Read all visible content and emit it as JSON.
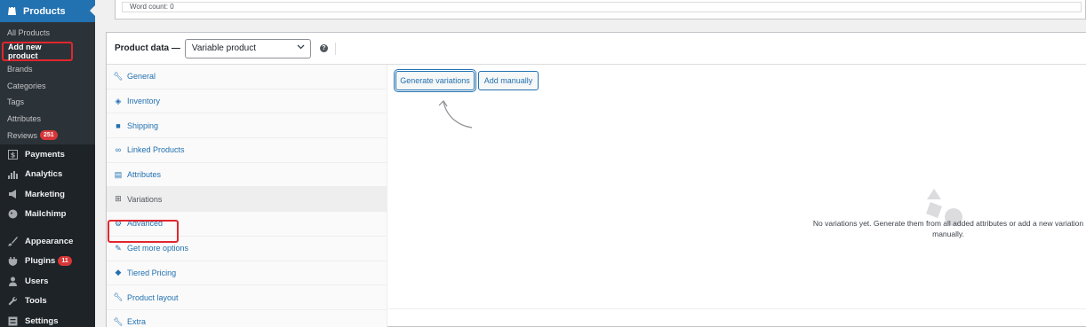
{
  "sidebar": {
    "current_menu": {
      "label": "Products",
      "icon": "products-bag-icon"
    },
    "submenu": [
      {
        "label": "All Products"
      },
      {
        "label": "Add new product",
        "active": true
      },
      {
        "label": "Brands"
      },
      {
        "label": "Categories"
      },
      {
        "label": "Tags"
      },
      {
        "label": "Attributes"
      },
      {
        "label": "Reviews",
        "badge": "251"
      }
    ],
    "menu": [
      {
        "label": "Payments",
        "icon": "payments-dollar-icon"
      },
      {
        "label": "Analytics",
        "icon": "analytics-bar-icon"
      },
      {
        "label": "Marketing",
        "icon": "marketing-megaphone-icon"
      },
      {
        "label": "Mailchimp",
        "icon": "mailchimp-icon"
      },
      {
        "label": "Appearance",
        "icon": "appearance-brush-icon"
      },
      {
        "label": "Plugins",
        "icon": "plugins-plug-icon",
        "badge": "11"
      },
      {
        "label": "Users",
        "icon": "users-icon"
      },
      {
        "label": "Tools",
        "icon": "tools-wrench-icon"
      },
      {
        "label": "Settings",
        "icon": "settings-icon"
      }
    ]
  },
  "editor": {
    "word_count": "Word count: 0"
  },
  "product_data": {
    "title": "Product data —",
    "type_select": {
      "value": "Variable product"
    },
    "help_icon": "help-icon",
    "tabs": [
      {
        "label": "General",
        "icon": "wrench-icon"
      },
      {
        "label": "Inventory",
        "icon": "tag-icon"
      },
      {
        "label": "Shipping",
        "icon": "truck-icon"
      },
      {
        "label": "Linked Products",
        "icon": "link-icon"
      },
      {
        "label": "Attributes",
        "icon": "list-card-icon"
      },
      {
        "label": "Variations",
        "icon": "grid-icon",
        "active": true
      },
      {
        "label": "Advanced",
        "icon": "gear-icon"
      },
      {
        "label": "Get more options",
        "icon": "plugin-icon"
      },
      {
        "label": "Tiered Pricing",
        "icon": "tag-icon"
      },
      {
        "label": "Product layout",
        "icon": "wrench-icon"
      },
      {
        "label": "Extra",
        "icon": "wrench-icon"
      }
    ],
    "buttons": {
      "generate": "Generate variations",
      "add_manually": "Add manually"
    },
    "empty_message": "No variations yet. Generate them from all added attributes or add a new variation manually."
  },
  "colors": {
    "sidebar_bg": "#1d2327",
    "accent": "#2271b1",
    "highlight_border": "#e1262d",
    "badge": "#d63638"
  }
}
